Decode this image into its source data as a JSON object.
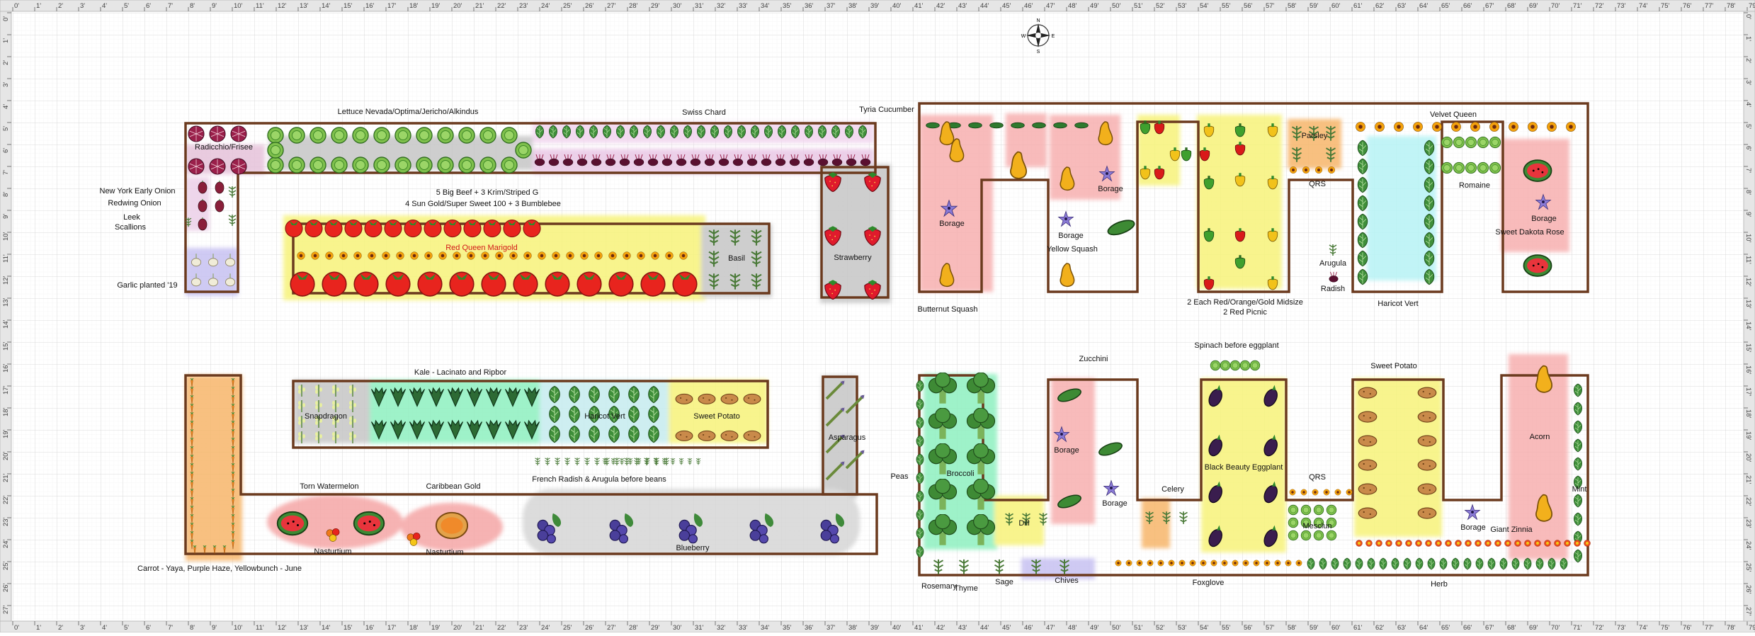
{
  "ruler": {
    "top": [
      "0'",
      "1'",
      "2'",
      "3'",
      "4'",
      "5'",
      "6'",
      "7'",
      "8'",
      "9'",
      "10'",
      "11'",
      "12'",
      "13'",
      "14'",
      "15'",
      "16'",
      "17'",
      "18'",
      "19'",
      "20'",
      "21'",
      "22'",
      "23'",
      "24'",
      "25'",
      "26'",
      "27'",
      "28'",
      "29'",
      "30'",
      "31'",
      "32'",
      "33'",
      "34'",
      "35'",
      "36'",
      "37'",
      "38'",
      "39'",
      "40'",
      "41'",
      "42'",
      "43'",
      "44'",
      "45'",
      "46'",
      "47'",
      "48'",
      "49'",
      "50'",
      "51'",
      "52'",
      "53'",
      "54'",
      "55'",
      "56'",
      "57'",
      "58'",
      "59'",
      "60'",
      "61'",
      "62'",
      "63'",
      "64'",
      "65'",
      "66'",
      "67'",
      "68'",
      "69'",
      "70'",
      "71'",
      "72'",
      "73'",
      "74'",
      "75'",
      "76'",
      "77'",
      "78'",
      "79'"
    ],
    "bottom": [
      "0'",
      "1'",
      "2'",
      "3'",
      "4'",
      "5'",
      "6'",
      "7'",
      "8'",
      "9'",
      "10'",
      "11'",
      "12'",
      "13'",
      "14'",
      "15'",
      "16'",
      "17'",
      "18'",
      "19'",
      "20'",
      "21'",
      "22'",
      "23'",
      "24'",
      "25'",
      "26'",
      "27'",
      "28'",
      "29'",
      "30'",
      "31'",
      "32'",
      "33'",
      "34'",
      "35'",
      "36'",
      "37'",
      "38'",
      "39'",
      "40'",
      "41'",
      "42'",
      "43'",
      "44'",
      "45'",
      "46'",
      "47'",
      "48'",
      "49'",
      "50'",
      "51'",
      "52'",
      "53'",
      "54'",
      "55'",
      "56'",
      "57'",
      "58'",
      "59'",
      "60'",
      "61'",
      "62'",
      "63'",
      "64'",
      "65'",
      "66'",
      "67'",
      "68'",
      "69'",
      "70'",
      "71'",
      "72'",
      "73'",
      "74'",
      "75'",
      "76'",
      "77'",
      "78'",
      "79'"
    ],
    "left": [
      "0'",
      "1'",
      "2'",
      "3'",
      "4'",
      "5'",
      "6'",
      "7'",
      "8'",
      "9'",
      "10'",
      "11'",
      "12'",
      "13'",
      "14'",
      "15'",
      "16'",
      "17'",
      "18'",
      "19'",
      "20'",
      "21'",
      "22'",
      "23'",
      "24'",
      "25'",
      "26'",
      "27'"
    ],
    "right": [
      "0'",
      "1'",
      "2'",
      "3'",
      "4'",
      "5'",
      "6'",
      "7'",
      "8'",
      "9'",
      "10'",
      "11'",
      "12'",
      "13'",
      "14'",
      "15'",
      "16'",
      "17'",
      "18'",
      "19'",
      "20'",
      "21'",
      "22'",
      "23'",
      "24'",
      "25'",
      "26'",
      "27'"
    ]
  },
  "compass": {
    "letters": [
      "N",
      "E",
      "S",
      "W"
    ]
  },
  "labels": {
    "lettuce": "Lettuce Nevada/Optima/Jericho/Alkindus",
    "swiss_chard": "Swiss Chard",
    "tyria_cucumber": "Tyria Cucumber",
    "radicchio": "Radicchio/Frisee",
    "ny_onion": "New York Early Onion",
    "redwing_onion": "Redwing Onion",
    "leek": "Leek",
    "scallions": "Scallions",
    "garlic": "Garlic planted '19",
    "tomato_line1": "5 Big Beef + 3 Krim/Striped G",
    "tomato_line2": "4 Sun Gold/Super Sweet 100 + 3 Bumblebee",
    "red_queen_marigold": "Red Queen Marigold",
    "basil": "Basil",
    "strawberry": "Strawberry",
    "kale": "Kale - Lacinato and Ripbor",
    "snapdragon": "Snapdragon",
    "haricot_vert_left": "Haricot Vert",
    "sweet_potato_left": "Sweet Potato",
    "asparagus": "Asparagus",
    "french_radish": "French Radish & Arugula before beans",
    "torn_watermelon": "Torn Watermelon",
    "caribbean_gold": "Caribbean Gold",
    "nasturtium1": "Nasturtium",
    "nasturtium2": "Nasturtium",
    "blueberry": "Blueberry",
    "carrot": "Carrot - Yaya, Purple Haze, Yellowbunch - June",
    "borage_a": "Borage",
    "butternut": "Butternut Squash",
    "borage_b": "Borage",
    "yellow_squash": "Yellow Squash",
    "borage_c": "Borage",
    "peppers_line1": "2 Each Red/Orange/Gold Midsize",
    "peppers_line2": "2 Red Picnic",
    "parsley": "Parsley",
    "qrs_top": "QRS",
    "arugula": "Arugula",
    "radish": "Radish",
    "velvet_queen": "Velvet Queen",
    "romaine": "Romaine",
    "haricot_vert_right": "Haricot Vert",
    "borage_d": "Borage",
    "sweet_dakota_rose": "Sweet Dakota Rose",
    "spinach": "Spinach before eggplant",
    "zucchini": "Zucchini",
    "sweet_potato_right": "Sweet Potato",
    "peas": "Peas",
    "broccoli": "Broccoli",
    "borage_e": "Borage",
    "borage_f": "Borage",
    "dill": "Dill",
    "celery": "Celery",
    "eggplant": "Black Beauty Eggplant",
    "qrs_bottom": "QRS",
    "mesclun": "Mesclun",
    "borage_g": "Borage",
    "giant_zinnia": "Giant Zinnia",
    "acorn": "Acorn",
    "mint": "Mint",
    "rosemary": "Rosemary",
    "thyme": "Thyme",
    "sage": "Sage",
    "chives": "Chives",
    "foxglove": "Foxglove",
    "herb": "Herb"
  }
}
